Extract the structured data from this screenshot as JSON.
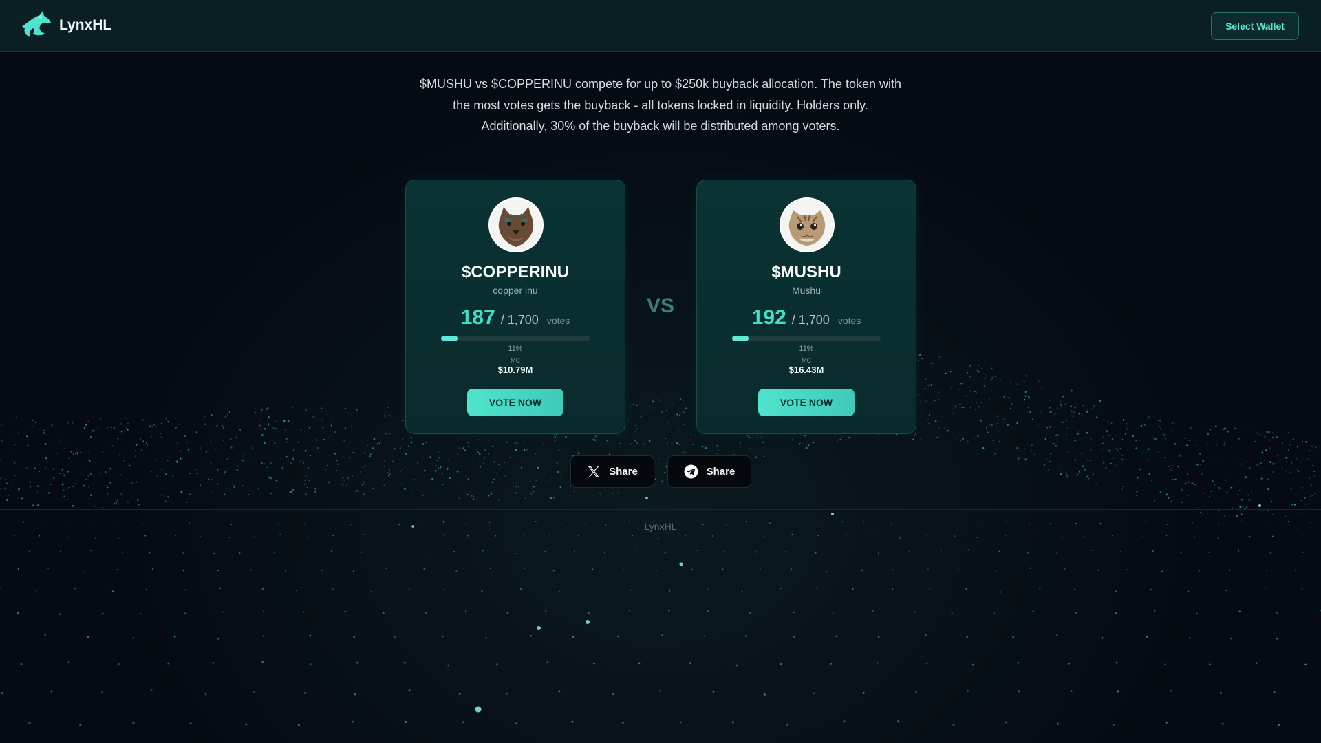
{
  "header": {
    "brand_name": "LynxHL",
    "wallet_button_label": "Select Wallet"
  },
  "intro": {
    "line1": "$MUSHU vs $COPPERINU compete for up to $250k buyback allocation. The token with the most votes gets the buyback - all tokens locked in liquidity. Holders only.",
    "line2": "Additionally, 30% of the buyback will be distributed among voters."
  },
  "vs_label": "VS",
  "cards": [
    {
      "ticker": "$COPPERINU",
      "name": "copper inu",
      "votes": "187",
      "votes_max": "/ 1,700",
      "votes_unit": "votes",
      "progress_fraction": 0.11,
      "percent_label": "11%",
      "mc_label": "MC",
      "mc_value": "$10.79M",
      "vote_button_label": "VOTE NOW"
    },
    {
      "ticker": "$MUSHU",
      "name": "Mushu",
      "votes": "192",
      "votes_max": "/ 1,700",
      "votes_unit": "votes",
      "progress_fraction": 0.11,
      "percent_label": "11%",
      "mc_label": "MC",
      "mc_value": "$16.43M",
      "vote_button_label": "VOTE NOW"
    }
  ],
  "share": {
    "x_label": "Share",
    "telegram_label": "Share"
  },
  "footer": {
    "text": "LynxHL"
  },
  "colors": {
    "accent": "#3fe0c9",
    "background": "#060a12",
    "card_bg": "#0b3334",
    "header_bg": "#0a1f24"
  },
  "icons": {
    "logo": "lynx-logo-icon",
    "x": "x-icon",
    "telegram": "telegram-icon"
  }
}
